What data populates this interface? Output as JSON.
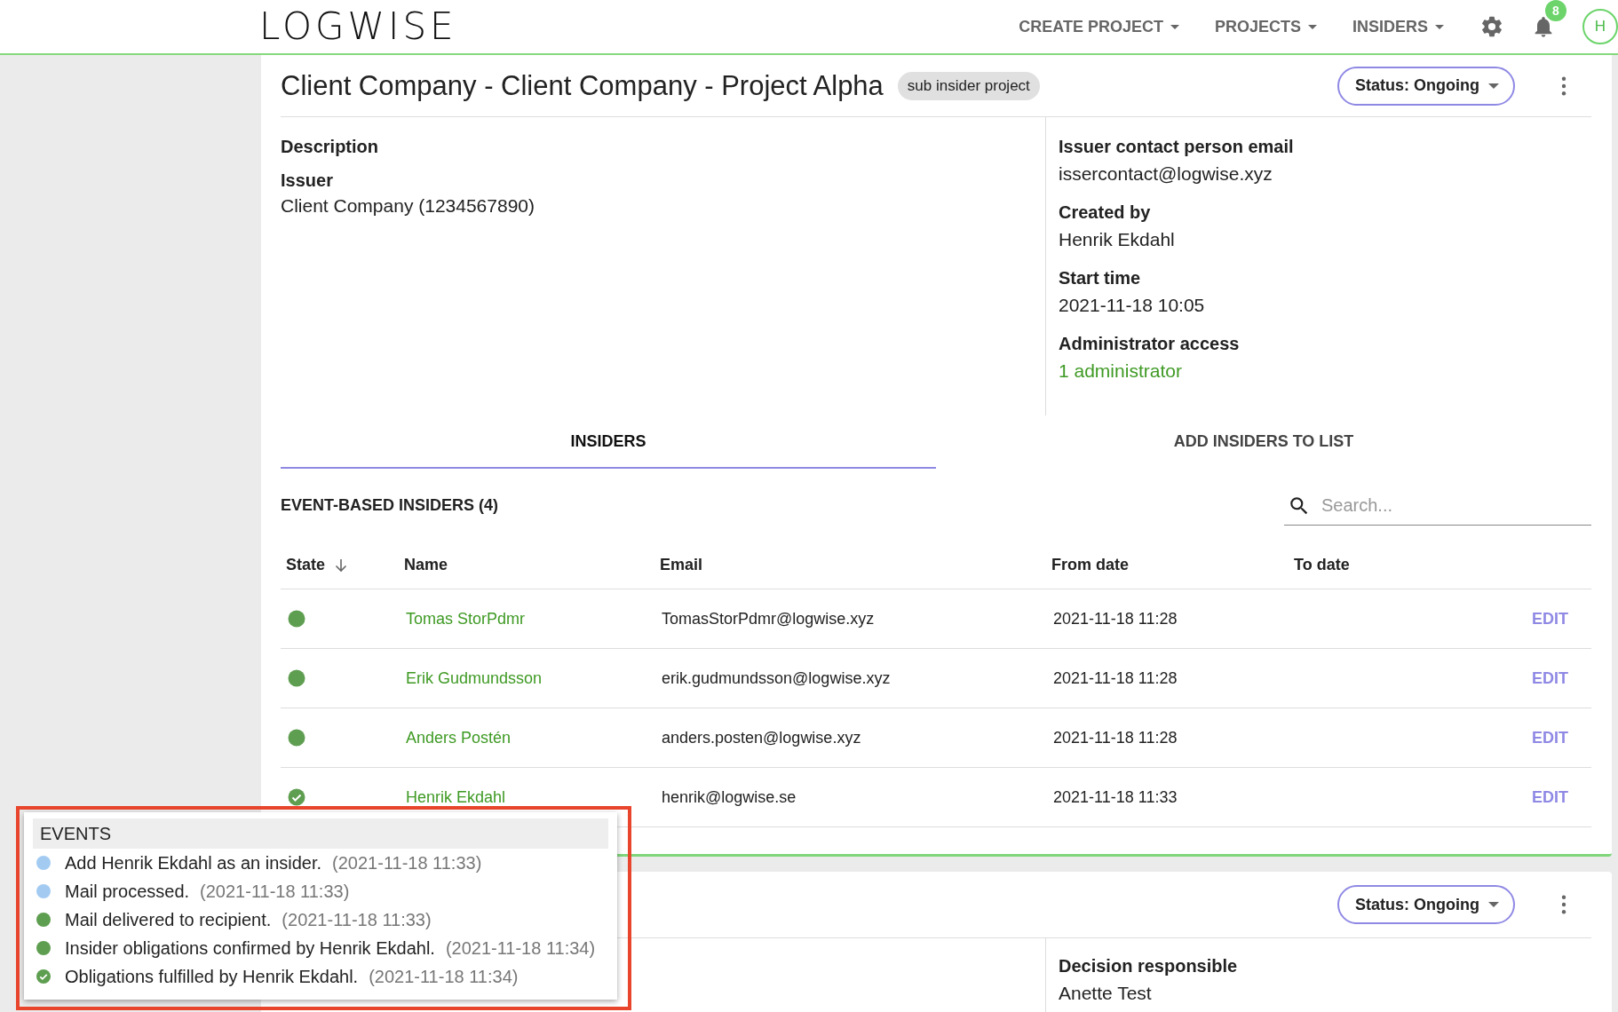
{
  "header": {
    "logo": "LOGWISE",
    "nav": [
      {
        "label": "CREATE PROJECT"
      },
      {
        "label": "PROJECTS"
      },
      {
        "label": "INSIDERS"
      }
    ],
    "notification_count": "8",
    "avatar": "H"
  },
  "project": {
    "title": "Client Company - Client Company - Project Alpha",
    "tag": "sub insider project",
    "status": "Status: Ongoing",
    "left_fields": [
      {
        "label": "Description"
      },
      {
        "label": "Issuer",
        "value": "Client Company (1234567890)"
      }
    ],
    "right_fields": [
      {
        "label": "Issuer contact person email",
        "value": "issercontact@logwise.xyz",
        "kind": "text"
      },
      {
        "label": "Created by",
        "value": "Henrik Ekdahl",
        "kind": "text"
      },
      {
        "label": "Start time",
        "value": "2021-11-18 10:05",
        "kind": "text"
      },
      {
        "label": "Administrator access",
        "value": "1 administrator",
        "kind": "link"
      }
    ]
  },
  "tabs": [
    {
      "label": "INSIDERS",
      "selected": true
    },
    {
      "label": "ADD INSIDERS TO LIST",
      "selected": false
    }
  ],
  "section_title": "EVENT-BASED INSIDERS (4)",
  "search": {
    "placeholder": "Search..."
  },
  "table": {
    "columns": [
      {
        "label": "State",
        "sorted": true
      },
      {
        "label": "Name",
        "sorted": false
      },
      {
        "label": "Email",
        "sorted": false
      },
      {
        "label": "From date",
        "sorted": false
      },
      {
        "label": "To date",
        "sorted": false
      }
    ],
    "rows": [
      {
        "kind": "active",
        "name": "Tomas StorPdmr",
        "email": "TomasStorPdmr@logwise.xyz",
        "from_date": "2021-11-18 11:28",
        "action": "EDIT"
      },
      {
        "kind": "active",
        "name": "Erik Gudmundsson",
        "email": "erik.gudmundsson@logwise.xyz",
        "from_date": "2021-11-18 11:28",
        "action": "EDIT"
      },
      {
        "kind": "active",
        "name": "Anders Postén",
        "email": "anders.posten@logwise.xyz",
        "from_date": "2021-11-18 11:28",
        "action": "EDIT"
      },
      {
        "kind": "fulfilled",
        "name": "Henrik Ekdahl",
        "email": "henrik@logwise.se",
        "from_date": "2021-11-18 11:33",
        "action": "EDIT"
      }
    ]
  },
  "events": {
    "title": "EVENTS",
    "items": [
      {
        "kind": "dot",
        "color": "#a3cbf2",
        "text": "Add Henrik Ekdahl as an insider.",
        "time": "(2021-11-18 11:33)"
      },
      {
        "kind": "dot",
        "color": "#a3cbf2",
        "text": "Mail processed.",
        "time": "(2021-11-18 11:33)"
      },
      {
        "kind": "dot",
        "color": "#5e9e50",
        "text": "Mail delivered to recipient.",
        "time": "(2021-11-18 11:33)"
      },
      {
        "kind": "dot",
        "color": "#5e9e50",
        "text": "Insider obligations confirmed by Henrik Ekdahl.",
        "time": "(2021-11-18 11:34)"
      },
      {
        "kind": "check",
        "color": "#5e9e50",
        "text": "Obligations fulfilled by Henrik Ekdahl.",
        "time": "(2021-11-18 11:34)"
      }
    ]
  },
  "second_project": {
    "status": "Status: Ongoing",
    "fields": [
      {
        "label": "Decision responsible",
        "value": "Anette Test"
      }
    ]
  }
}
